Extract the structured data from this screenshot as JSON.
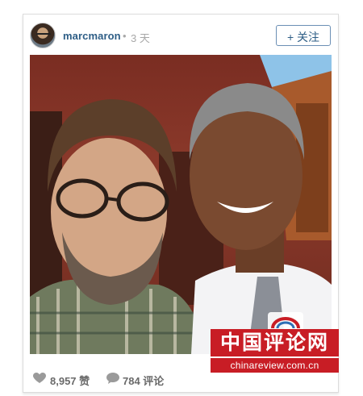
{
  "post": {
    "username": "marcmaron",
    "separator": "•",
    "time": "3 天",
    "follow_label": "+ 关注",
    "likes": "8,957 赞",
    "comments": "784 评论"
  },
  "watermark": {
    "title": "中国评论网",
    "url": "chinareview.com.cn"
  },
  "icons": {
    "like": "heart-icon",
    "comment": "speech-bubble-icon"
  },
  "colors": {
    "username": "#2e5e86",
    "meta": "#a8a8a8",
    "watermark_bg": "#c81d25"
  }
}
